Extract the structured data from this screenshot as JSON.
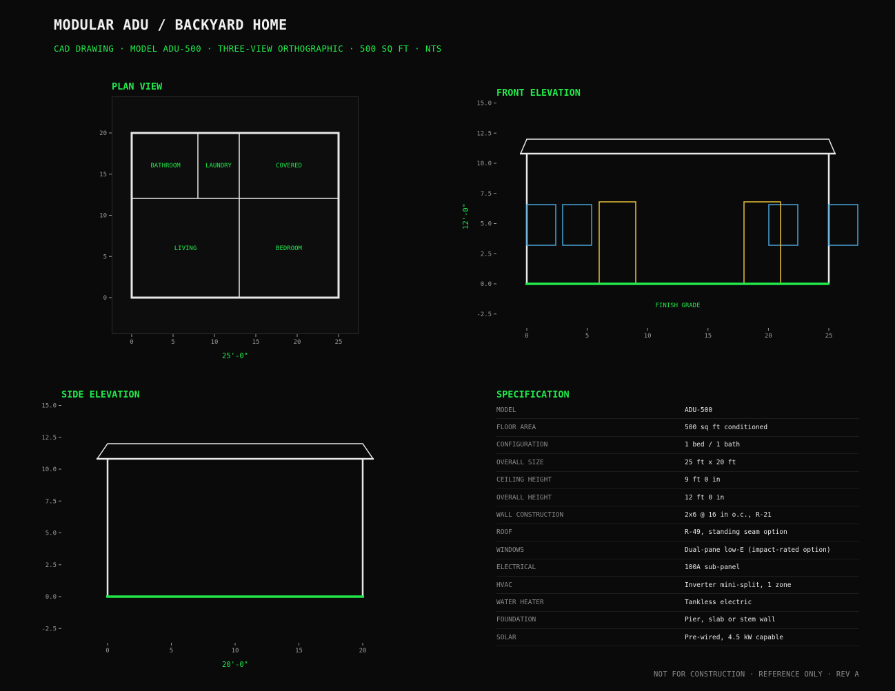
{
  "header": {
    "title": "MODULAR ADU / BACKYARD HOME",
    "subtitle": "CAD DRAWING  ·  MODEL ADU-500  ·  THREE-VIEW ORTHOGRAPHIC  ·  500 SQ FT  ·  NTS"
  },
  "plan": {
    "title": "PLAN VIEW",
    "width_label": "25'-0\"",
    "x_ticks": [
      0,
      5,
      10,
      15,
      20,
      25
    ],
    "y_ticks": [
      0,
      5,
      10,
      15,
      20
    ],
    "rooms": [
      "BATHROOM",
      "LAUNDRY",
      "COVERED",
      "LIVING",
      "BEDROOM"
    ]
  },
  "front": {
    "title": "FRONT ELEVATION",
    "height_label": "12'-0\"",
    "grade_label": "FINISH GRADE",
    "x_ticks": [
      0,
      5,
      10,
      15,
      20,
      25
    ],
    "y_ticks": [
      "15.0",
      "12.5",
      "10.0",
      "7.5",
      "5.0",
      "2.5",
      "0.0",
      "-2.5"
    ]
  },
  "side": {
    "title": "SIDE ELEVATION",
    "width_label": "20'-0\"",
    "x_ticks": [
      0,
      5,
      10,
      15,
      20
    ],
    "y_ticks": [
      "15.0",
      "12.5",
      "10.0",
      "7.5",
      "5.0",
      "2.5",
      "0.0",
      "-2.5"
    ]
  },
  "spec": {
    "title": "SPECIFICATION",
    "rows": [
      {
        "key": "MODEL",
        "value": "ADU-500"
      },
      {
        "key": "FLOOR AREA",
        "value": "500 sq ft conditioned"
      },
      {
        "key": "CONFIGURATION",
        "value": "1 bed / 1 bath"
      },
      {
        "key": "OVERALL SIZE",
        "value": "25 ft x 20 ft"
      },
      {
        "key": "CEILING HEIGHT",
        "value": "9 ft 0 in"
      },
      {
        "key": "OVERALL HEIGHT",
        "value": "12 ft 0 in"
      },
      {
        "key": "WALL CONSTRUCTION",
        "value": "2x6 @ 16 in o.c., R-21"
      },
      {
        "key": "ROOF",
        "value": "R-49, standing seam option"
      },
      {
        "key": "WINDOWS",
        "value": "Dual-pane low-E (impact-rated option)"
      },
      {
        "key": "ELECTRICAL",
        "value": "100A sub-panel"
      },
      {
        "key": "HVAC",
        "value": "Inverter mini-split, 1 zone"
      },
      {
        "key": "WATER HEATER",
        "value": "Tankless electric"
      },
      {
        "key": "FOUNDATION",
        "value": "Pier, slab or stem wall"
      },
      {
        "key": "SOLAR",
        "value": "Pre-wired, 4.5 kW capable"
      }
    ]
  },
  "footer": "NOT FOR CONSTRUCTION · REFERENCE ONLY · REV A",
  "colors": {
    "accent": "#22e84a",
    "wall": "#e8e8e8",
    "window": "#4aa3d8",
    "door": "#e8c23a",
    "background": "#0a0a0a"
  }
}
